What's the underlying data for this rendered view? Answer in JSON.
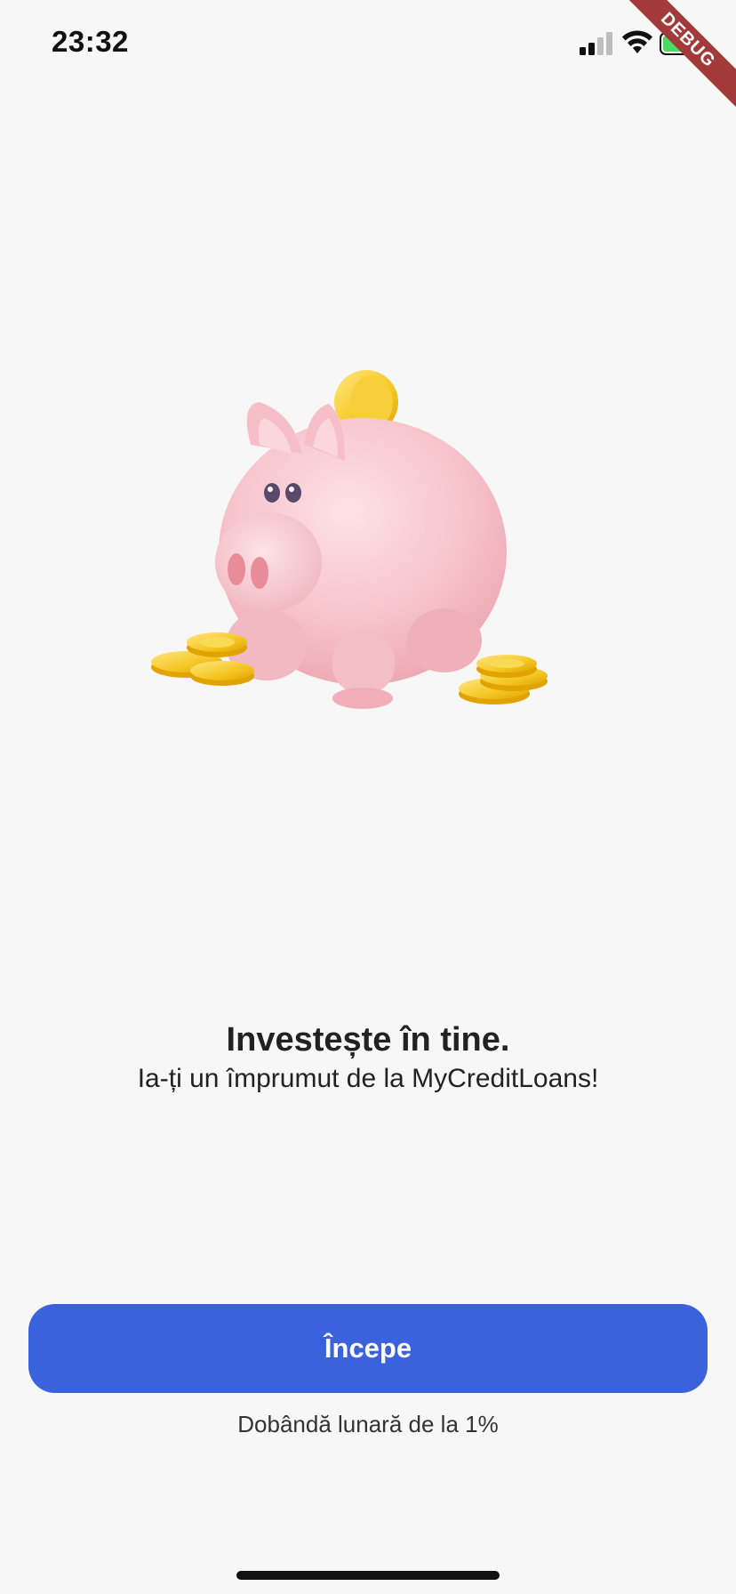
{
  "status_bar": {
    "time": "23:32"
  },
  "debug_banner": {
    "label": "DEBUG"
  },
  "hero": {
    "illustration": "piggy-bank-with-coins"
  },
  "intro": {
    "title": "Investește în tine.",
    "subtitle": "Ia-ți un împrumut de la MyCreditLoans!"
  },
  "actions": {
    "start_label": "Începe"
  },
  "footer": {
    "note": "Dobândă lunară de la 1%"
  },
  "colors": {
    "background": "#f7f7f7",
    "primary": "#3a62dd",
    "text": "#222222",
    "debug_ribbon": "#a33a3a",
    "battery": "#4cd964"
  }
}
